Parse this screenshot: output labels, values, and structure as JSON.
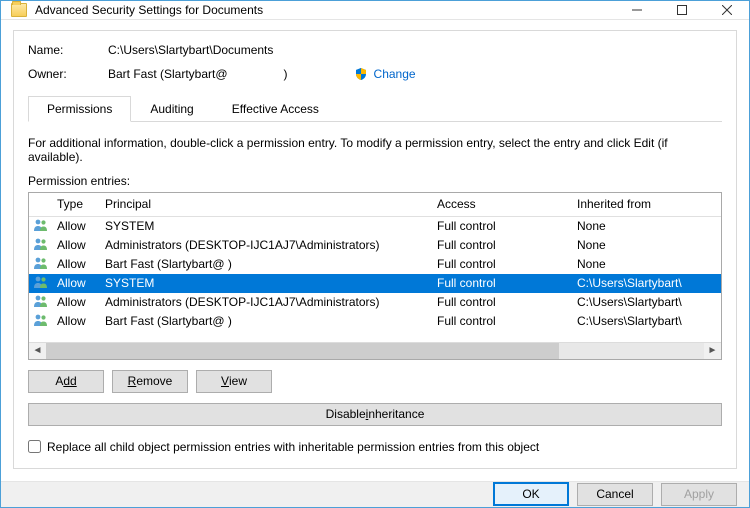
{
  "titlebar": {
    "title": "Advanced Security Settings for Documents"
  },
  "meta": {
    "name_label": "Name:",
    "name_value": "C:\\Users\\Slartybart\\Documents",
    "owner_label": "Owner:",
    "owner_value": "Bart Fast (Slartybart@",
    "owner_close": ")",
    "change": "Change"
  },
  "tabs": {
    "permissions": "Permissions",
    "auditing": "Auditing",
    "effective": "Effective Access"
  },
  "info": "For additional information, double-click a permission entry. To modify a permission entry, select the entry and click Edit (if available).",
  "entries_label": "Permission entries:",
  "columns": {
    "type": "Type",
    "principal": "Principal",
    "access": "Access",
    "inherited": "Inherited from"
  },
  "rows": [
    {
      "type": "Allow",
      "principal": "SYSTEM",
      "access": "Full control",
      "inherited": "None",
      "selected": false
    },
    {
      "type": "Allow",
      "principal": "Administrators (DESKTOP-IJC1AJ7\\Administrators)",
      "access": "Full control",
      "inherited": "None",
      "selected": false
    },
    {
      "type": "Allow",
      "principal": "Bart Fast (Slartybart@                               )",
      "access": "Full control",
      "inherited": "None",
      "selected": false
    },
    {
      "type": "Allow",
      "principal": "SYSTEM",
      "access": "Full control",
      "inherited": "C:\\Users\\Slartybart\\",
      "selected": true
    },
    {
      "type": "Allow",
      "principal": "Administrators (DESKTOP-IJC1AJ7\\Administrators)",
      "access": "Full control",
      "inherited": "C:\\Users\\Slartybart\\",
      "selected": false
    },
    {
      "type": "Allow",
      "principal": "Bart Fast (Slartybart@                               )",
      "access": "Full control",
      "inherited": "C:\\Users\\Slartybart\\",
      "selected": false
    }
  ],
  "buttons": {
    "add": "dd",
    "remove": "emove",
    "view": "iew",
    "disable": "nheritance",
    "disable_prefix": "Disable "
  },
  "checkbox_label": "Replace all child object permission entries with inheritable permission entries from this object",
  "footer": {
    "ok": "OK",
    "cancel": "Cancel",
    "apply": "Apply"
  }
}
